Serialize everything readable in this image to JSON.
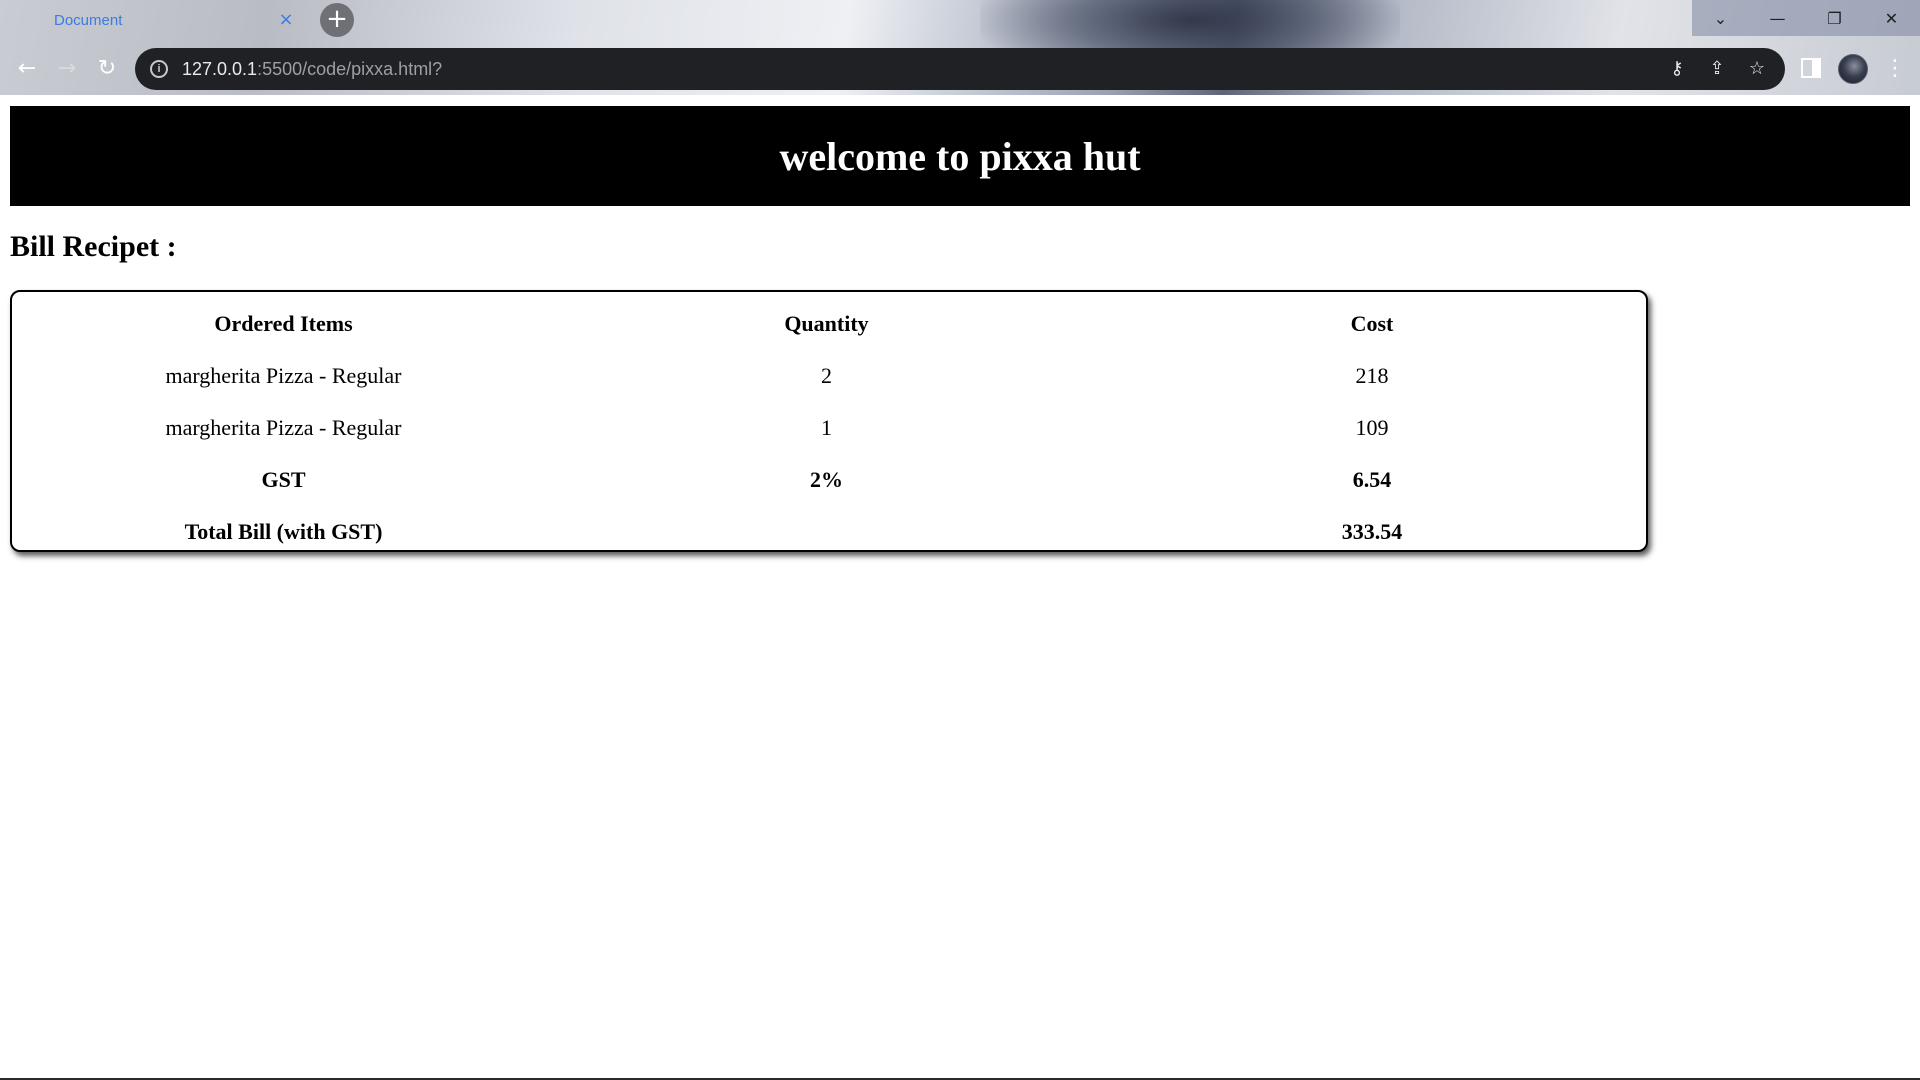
{
  "browser": {
    "tab_title": "Document",
    "tab_close": "×",
    "new_tab": "+",
    "url_host": "127.0.0.1",
    "url_path": ":5500/code/pixxa.html?",
    "window_controls": {
      "dropdown": "⌄",
      "minimize": "—",
      "restore": "❐",
      "close": "✕"
    },
    "nav": {
      "back": "←",
      "forward": "→",
      "reload": "↻"
    },
    "omnibox_icons": [
      "key-icon",
      "share-icon",
      "star-icon"
    ]
  },
  "page": {
    "banner_title": "welcome to pixxa hut",
    "bill_heading": "Bill Recipet :",
    "table": {
      "headers": [
        "Ordered Items",
        "Quantity",
        "Cost"
      ],
      "rows": [
        [
          "margherita Pizza - Regular",
          "2",
          "218"
        ],
        [
          "margherita Pizza - Regular",
          "1",
          "109"
        ]
      ],
      "gst": [
        "GST",
        "2%",
        "6.54"
      ],
      "total": [
        "Total Bill (with GST)",
        "",
        "333.54"
      ]
    }
  },
  "colors": {
    "banner_bg": "#000000",
    "banner_text": "#ffffff",
    "tab_text": "#3b7be0",
    "omnibox_bg": "#202124"
  }
}
